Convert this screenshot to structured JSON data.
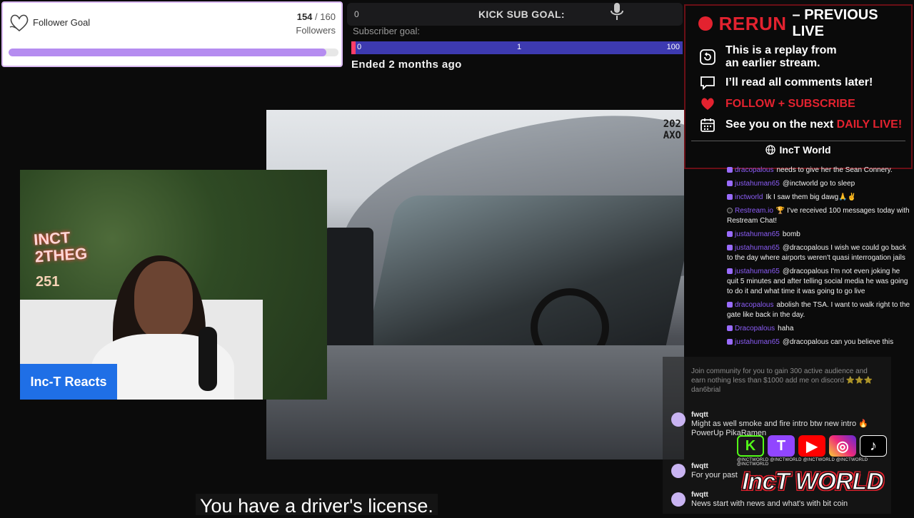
{
  "follower_goal": {
    "title": "Follower Goal",
    "current": "154",
    "separator": "/",
    "target": "160",
    "unit_label": "Followers",
    "progress": 0.9625
  },
  "kick_goal": {
    "start_value": "0",
    "title": "KICK SUB GOAL:",
    "subtitle": "Subscriber goal:",
    "bar_start": "0",
    "bar_mid": "1",
    "bar_end": "100",
    "ended_text": "Ended 2 months ago",
    "bar_color": "#3d3ab0",
    "marker_color": "#ff3e6a"
  },
  "rerun": {
    "word": "RERUN",
    "dash_title": "– PREVIOUS LIVE",
    "line1a": "This is a replay from",
    "line1b": "an earlier stream.",
    "line2": "I’ll read all comments later!",
    "line3": "FOLLOW + SUBSCRIBE",
    "line4_prefix": "See you on the next ",
    "line4_highlight": "DAILY LIVE!",
    "footer": "IncT World",
    "accent": "#e3222f"
  },
  "video": {
    "stamp_line1": "202",
    "stamp_line2": "AXO"
  },
  "webcam": {
    "label": "Inc-T Reacts",
    "neon_line1": "INCT",
    "neon_line2": "2THEG",
    "neon_line3": "251"
  },
  "caption": "You have a driver's license.",
  "chat": [
    {
      "user": "dracopalous",
      "text": "needs to give her the Sean Connery."
    },
    {
      "user": "justahuman65",
      "text": "@inctworld go to sleep"
    },
    {
      "user": "inctworld",
      "text": "Ik I saw them big dawg🙏✌️"
    },
    {
      "user": "Restream.io",
      "text": "🏆 I've received 100 messages today with Restream Chat!"
    },
    {
      "user": "justahuman65",
      "text": "bomb"
    },
    {
      "user": "justahuman65",
      "text": "@dracopalous I wish we could go back to the day where airports weren't quasi interrogation jails"
    },
    {
      "user": "justahuman65",
      "text": "@dracopalous I'm not even joking he quit 5 minutes and after telling social media he was going to do it and what time it was going to go live"
    },
    {
      "user": "dracopalous",
      "text": "abolish the TSA. I want to walk right to the gate like back in the day."
    },
    {
      "user": "Dracopalous",
      "text": "haha"
    },
    {
      "user": "justahuman65",
      "text": "@dracopalous can you believe this"
    }
  ],
  "chat2": {
    "blurred": "Join community for you to gain 300 active audience and earn nothing less than $1000 add me on discord ⭐⭐⭐ dan6brial",
    "messages": [
      {
        "user": "fwqtt",
        "text": "Might as well smoke and fire intro btw new intro 🔥 PowerUp PikaRamen"
      },
      {
        "user": "fwqtt",
        "text": "For your past"
      },
      {
        "user": "fwqtt",
        "text": "News start with news and what's with bit coin"
      }
    ]
  },
  "social": {
    "kick": "K",
    "twitch": "T",
    "youtube": "▶",
    "instagram": "◎",
    "tiktok": "♪",
    "handles": "@INCTWORLD @INCTWORLD @INCTWORLD @INCTWORLD @INCTWORLD",
    "logo_text": "IncT WORLD"
  }
}
